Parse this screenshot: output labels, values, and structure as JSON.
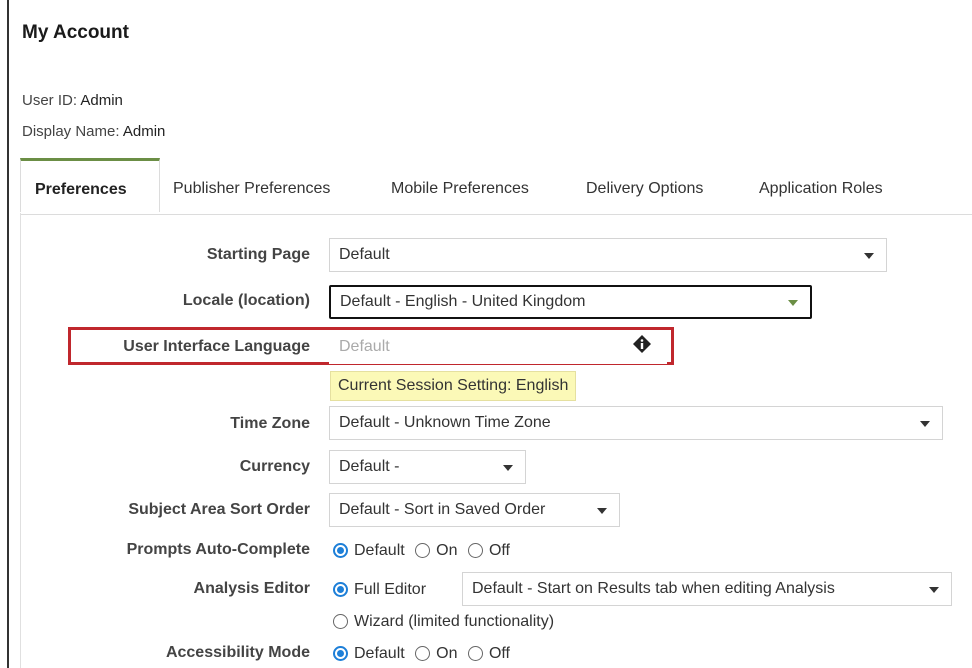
{
  "page": {
    "title": "My Account"
  },
  "user": {
    "user_id_label": "User ID:",
    "user_id": "Admin",
    "display_name_label": "Display Name:",
    "display_name": "Admin"
  },
  "tabs": [
    {
      "label": "Preferences",
      "active": true
    },
    {
      "label": "Publisher Preferences",
      "active": false
    },
    {
      "label": "Mobile Preferences",
      "active": false
    },
    {
      "label": "Delivery Options",
      "active": false
    },
    {
      "label": "Application Roles",
      "active": false
    }
  ],
  "form": {
    "starting_page": {
      "label": "Starting Page",
      "value": "Default"
    },
    "locale": {
      "label": "Locale (location)",
      "value": "Default - English - United Kingdom"
    },
    "ui_language": {
      "label": "User Interface Language",
      "placeholder": "Default",
      "note": "Current Session Setting: English"
    },
    "time_zone": {
      "label": "Time Zone",
      "value": "Default - Unknown Time Zone"
    },
    "currency": {
      "label": "Currency",
      "value": "Default -"
    },
    "sort_order": {
      "label": "Subject Area Sort Order",
      "value": "Default - Sort in Saved Order"
    },
    "prompts_auto_complete": {
      "label": "Prompts Auto-Complete",
      "options": [
        "Default",
        "On",
        "Off"
      ],
      "selected": "Default"
    },
    "analysis_editor": {
      "label": "Analysis Editor",
      "option_full": "Full Editor",
      "full_editor_default": "Default - Start on Results tab when editing Analysis",
      "option_wizard": "Wizard (limited functionality)",
      "selected": "Full Editor"
    },
    "accessibility_mode": {
      "label": "Accessibility Mode",
      "options": [
        "Default",
        "On",
        "Off"
      ],
      "selected": "Default"
    }
  },
  "colors": {
    "accent_green": "#6b8e45",
    "highlight_red": "#c0272d",
    "radio_blue": "#1d7fd8",
    "note_yellow": "#fbf9b7"
  }
}
